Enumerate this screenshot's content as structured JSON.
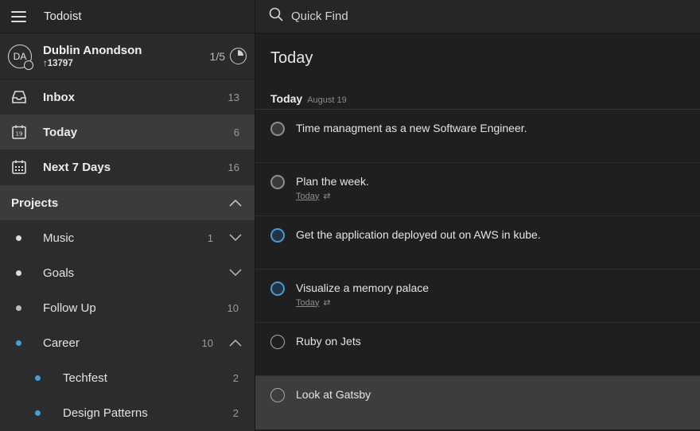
{
  "app": {
    "title": "Todoist"
  },
  "user": {
    "initials": "DA",
    "name": "Dublin Anondson",
    "karma": "↑13797",
    "goal": "1/5"
  },
  "nav": [
    {
      "label": "Inbox",
      "count": "13",
      "icon": "inbox-icon"
    },
    {
      "label": "Today",
      "count": "6",
      "icon": "calendar-today-icon",
      "active": true,
      "day": "19"
    },
    {
      "label": "Next 7 Days",
      "count": "16",
      "icon": "calendar-week-icon"
    }
  ],
  "projects": {
    "label": "Projects",
    "items": [
      {
        "label": "Music",
        "count": "1",
        "color": "#dcdcdc",
        "expand": "down"
      },
      {
        "label": "Goals",
        "count": "",
        "color": "#dcdcdc",
        "expand": "down"
      },
      {
        "label": "Follow Up",
        "count": "10",
        "color": "#bdbdbd",
        "expand": ""
      },
      {
        "label": "Career",
        "count": "10",
        "color": "#4a9ad4",
        "expand": "up"
      },
      {
        "label": "Techfest",
        "count": "2",
        "color": "#4a9ad4",
        "expand": "",
        "sub": true
      },
      {
        "label": "Design Patterns",
        "count": "2",
        "color": "#4a9ad4",
        "expand": "",
        "sub": true
      }
    ]
  },
  "search": {
    "placeholder": "Quick Find"
  },
  "main": {
    "title": "Today",
    "section": {
      "title": "Today",
      "date": "August 19"
    },
    "tasks": [
      {
        "content": "Time managment as a new Software Engineer.",
        "priority": "grey",
        "due": "",
        "recurring": false
      },
      {
        "content": "Plan the week.",
        "priority": "grey",
        "due": "Today",
        "recurring": true
      },
      {
        "content": "Get the application deployed out on AWS in kube.",
        "priority": "blue",
        "due": "",
        "recurring": false
      },
      {
        "content": "Visualize a memory palace",
        "priority": "blue",
        "due": "Today",
        "recurring": true
      },
      {
        "content": "Ruby on Jets",
        "priority": "none",
        "due": "",
        "recurring": false
      },
      {
        "content": "Look at Gatsby",
        "priority": "none",
        "due": "",
        "recurring": false,
        "hover": true
      }
    ]
  },
  "colors": {
    "accent": "#4a9ad4",
    "sidebar": "#2c2c2c",
    "active_row": "#3b3b3b",
    "main_bg": "#1f1f1f"
  }
}
